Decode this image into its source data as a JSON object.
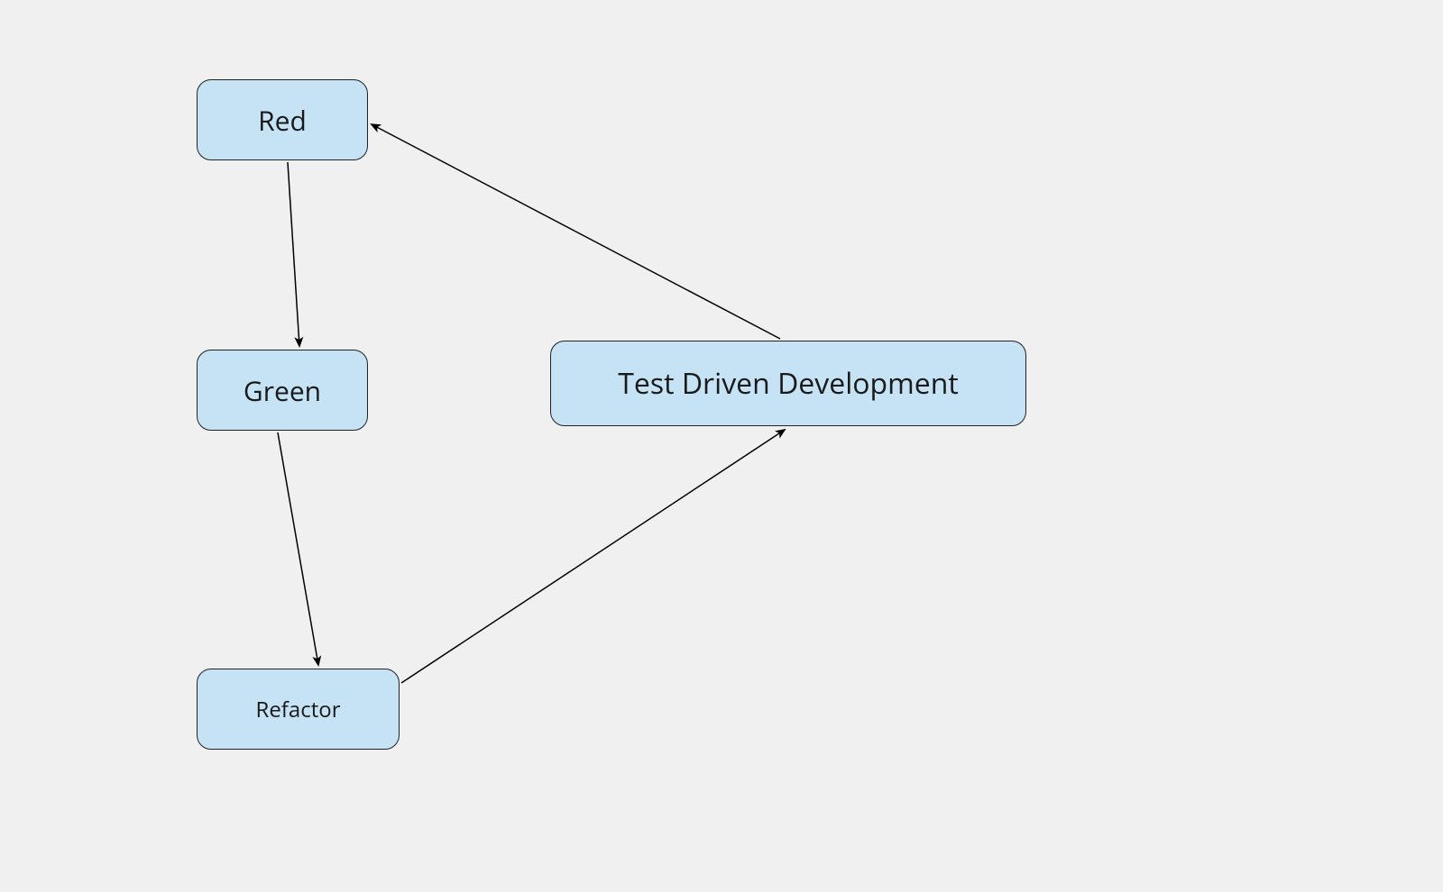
{
  "diagram": {
    "nodes": {
      "red": {
        "label": "Red"
      },
      "green": {
        "label": "Green"
      },
      "refactor": {
        "label": "Refactor"
      },
      "tdd": {
        "label": "Test Driven Development"
      }
    },
    "edges": [
      {
        "from": "red",
        "to": "green"
      },
      {
        "from": "green",
        "to": "refactor"
      },
      {
        "from": "refactor",
        "to": "tdd"
      },
      {
        "from": "tdd",
        "to": "red"
      }
    ],
    "style": {
      "node_fill": "#c5e3f5",
      "node_stroke": "#000000",
      "background": "#f0f0f0"
    }
  }
}
